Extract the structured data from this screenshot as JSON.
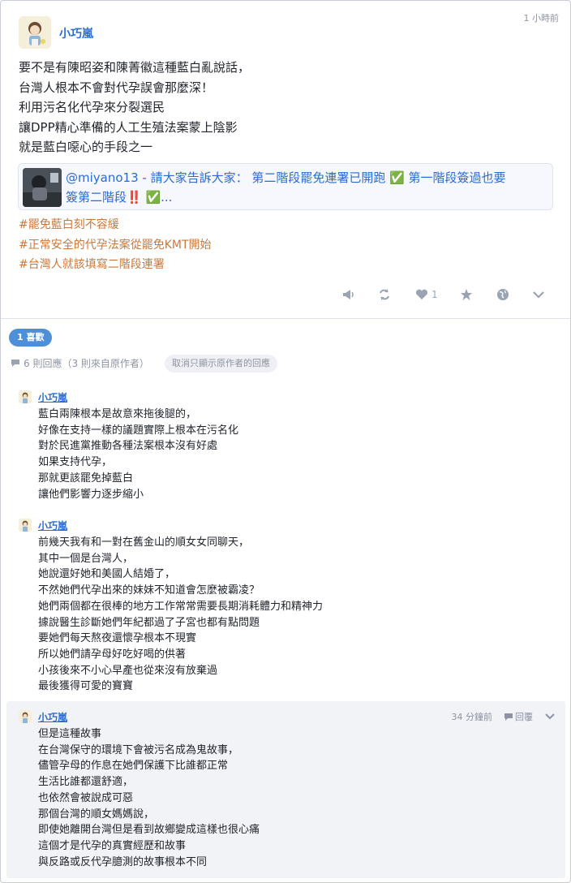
{
  "post": {
    "author": "小巧嵐",
    "timestamp": "1 小時前",
    "lines": [
      "要不是有陳昭姿和陳菁徽這種藍白亂說話，",
      "台灣人根本不會對代孕誤會那麼深！",
      "利用污名化代孕來分裂選民",
      "讓DPP精心準備的人工生殖法案蒙上陰影",
      "就是藍白噁心的手段之一"
    ],
    "card": {
      "text_part1": "@miyano13 - 請大家告訴大家： 第二階段罷免連署已開跑 ✅ 第一階段簽過也要",
      "text_part2": "簽第二階段‼️ ✅..."
    },
    "hashtags": [
      "#罷免藍白刻不容緩",
      "#正常安全的代孕法案從罷免KMT開始",
      "#台灣人就該填寫二階段連署"
    ],
    "actions": {
      "like_count": "1"
    }
  },
  "likes_badge": "1 喜歡",
  "reply_summary": "6 則回應（3 則來自原作者）",
  "filter_label": "取消只顯示原作者的回應",
  "replies": [
    {
      "author": "小巧嵐",
      "lines": [
        "藍白兩陳根本是故意來拖後腿的，",
        "好像在支持一樣的議題實際上根本在污名化",
        "對於民進黨推動各種法案根本沒有好處",
        "如果支持代孕，",
        "那就更該罷免掉藍白",
        "讓他們影響力逐步縮小"
      ]
    },
    {
      "author": "小巧嵐",
      "lines": [
        "前幾天我有和一對在舊金山的順女女同聊天，",
        "其中一個是台灣人，",
        "她說還好她和美國人結婚了，",
        "不然她們代孕出來的妹妹不知道會怎麼被霸凌？",
        "她們兩個都在很棒的地方工作常常需要長期消耗體力和精神力",
        "據說醫生診斷她們年紀都過了子宮也都有點問題",
        "要她們每天熬夜還懷孕根本不現實",
        "所以她們請孕母好吃好喝的供著",
        "小孩後來不小心早產也從來沒有放棄過",
        "最後獲得可愛的寶寶"
      ]
    },
    {
      "author": "小巧嵐",
      "timestamp": "34 分鐘前",
      "reply_label": "回覆",
      "lines": [
        "但是這種故事",
        "在台灣保守的環境下會被污名成為鬼故事，",
        "儘管孕母的作息在她們保護下比誰都正常",
        "生活比誰都還舒適，",
        "也依然會被說成可惡",
        "那個台灣的順女媽媽說，",
        "即使她離開台灣但是看到故鄉變成這樣也很心痛",
        "這個才是代孕的真實經歷和故事",
        "與反路或反代孕臆測的故事根本不同"
      ]
    }
  ],
  "colors": {
    "link": "#2b6cd3",
    "hashtag": "#c9773b",
    "badge": "#4d8fd8",
    "icon": "#9aa3b4"
  }
}
